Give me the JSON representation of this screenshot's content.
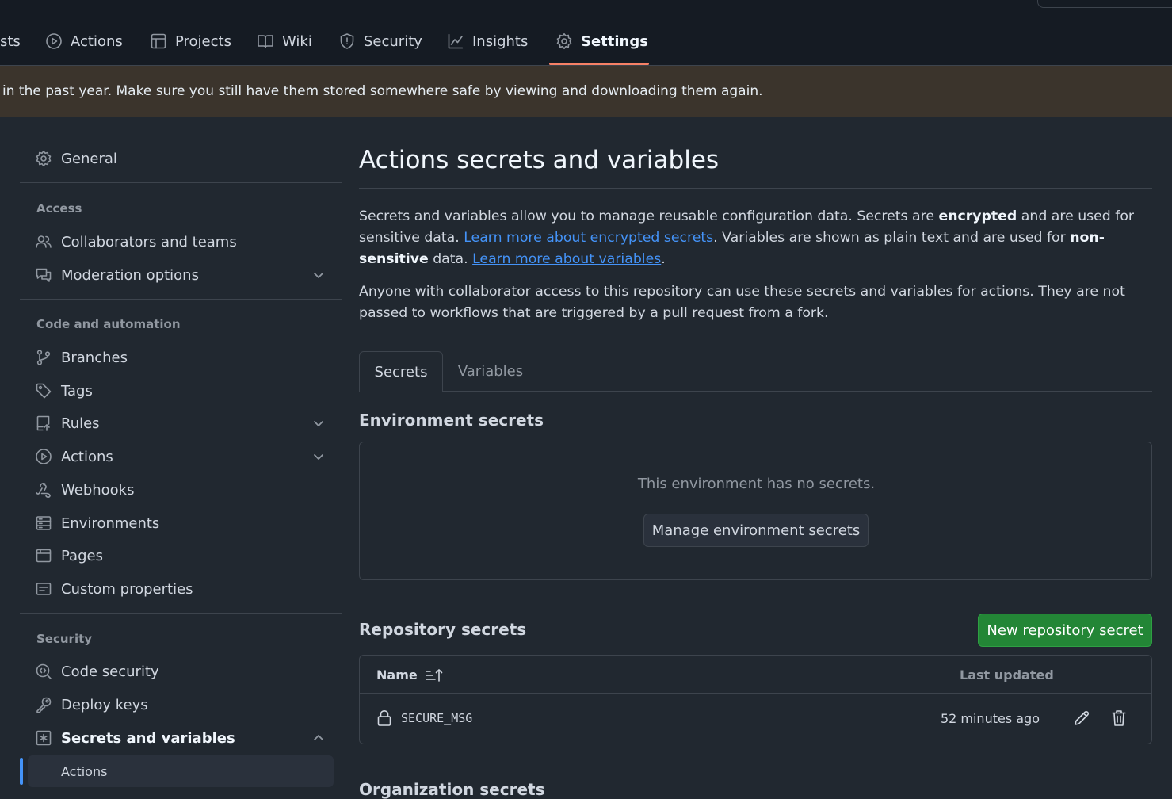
{
  "repo_nav": {
    "tabs": [
      {
        "label": "sts",
        "icon": "pull-request-icon"
      },
      {
        "label": "Actions",
        "icon": "play-circle-icon"
      },
      {
        "label": "Projects",
        "icon": "table-icon"
      },
      {
        "label": "Wiki",
        "icon": "book-icon"
      },
      {
        "label": "Security",
        "icon": "shield-icon"
      },
      {
        "label": "Insights",
        "icon": "graph-icon"
      },
      {
        "label": "Settings",
        "icon": "gear-icon",
        "active": true
      }
    ]
  },
  "banner": {
    "text": "in the past year. Make sure you still have them stored somewhere safe by viewing and downloading them again."
  },
  "sidebar": {
    "general": "General",
    "access_heading": "Access",
    "access_items": [
      "Collaborators and teams",
      "Moderation options"
    ],
    "code_heading": "Code and automation",
    "code_items": [
      "Branches",
      "Tags",
      "Rules",
      "Actions",
      "Webhooks",
      "Environments",
      "Pages",
      "Custom properties"
    ],
    "security_heading": "Security",
    "security_items": [
      "Code security",
      "Deploy keys",
      "Secrets and variables"
    ],
    "active_sub_item": "Actions"
  },
  "main": {
    "title": "Actions secrets and variables",
    "intro": {
      "p1_a": "Secrets and variables allow you to manage reusable configuration data. Secrets are ",
      "p1_b": "encrypted",
      "p1_c": " and are used for sensitive data. ",
      "p1_link1": "Learn more about encrypted secrets",
      "p1_d": ". Variables are shown as plain text and are used for ",
      "p1_e": "non-sensitive",
      "p1_f": " data. ",
      "p1_link2": "Learn more about variables",
      "p1_g": ".",
      "p2": "Anyone with collaborator access to this repository can use these secrets and variables for actions. They are not passed to workflows that are triggered by a pull request from a fork."
    },
    "tabs": [
      "Secrets",
      "Variables"
    ],
    "env_secrets": {
      "title": "Environment secrets",
      "empty_text": "This environment has no secrets.",
      "manage_button": "Manage environment secrets"
    },
    "repo_secrets": {
      "title": "Repository secrets",
      "new_button": "New repository secret",
      "col_name": "Name",
      "col_updated": "Last updated",
      "rows": [
        {
          "name": "SECURE_MSG",
          "updated": "52 minutes ago"
        }
      ]
    },
    "org_secrets": {
      "title": "Organization secrets"
    }
  },
  "colors": {
    "background": "#212830",
    "header": "#151b23",
    "banner": "#3b342c",
    "accent_underline": "#f78166",
    "link": "#4493f8",
    "green_button": "#238636"
  }
}
